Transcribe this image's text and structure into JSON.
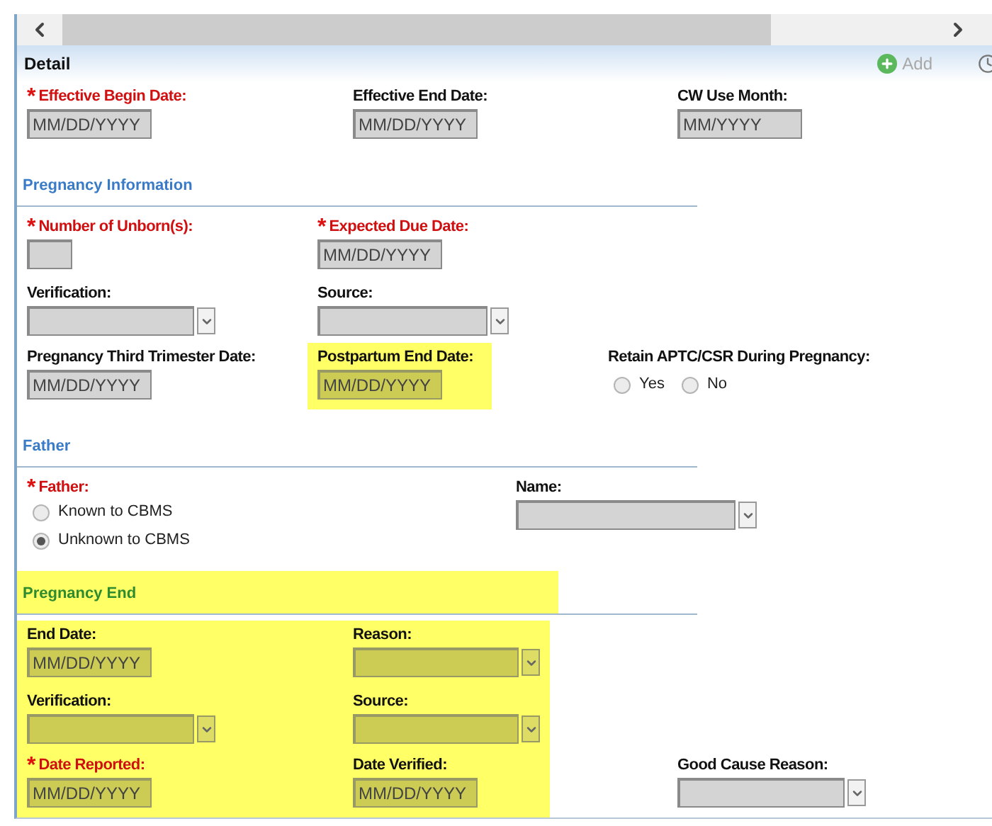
{
  "panel": {
    "title": "Detail",
    "add_button": {
      "label": "Add",
      "disabled": true
    }
  },
  "sections": [
    {
      "highlighted": false,
      "rows": [
        [
          {
            "kind": "date",
            "label": "Effective Begin Date:",
            "marker": "*",
            "placeholder": "MM/DD/YYYY",
            "highlighted": false
          },
          {
            "kind": "date",
            "label": "Effective End Date:",
            "placeholder": "MM/DD/YYYY",
            "highlighted": false
          },
          {
            "kind": "date",
            "label": "CW Use Month:",
            "placeholder": "MM/YYYY",
            "highlighted": false
          }
        ]
      ]
    },
    {
      "title": "Pregnancy Information",
      "highlighted": false,
      "rows": [
        [
          {
            "kind": "text",
            "label": "Number of Unborn(s):",
            "marker": "*",
            "highlighted": false
          },
          {
            "kind": "date",
            "label": "Expected Due Date:",
            "marker": "*",
            "placeholder": "MM/DD/YYYY",
            "highlighted": false
          }
        ],
        [
          {
            "kind": "select",
            "label": "Verification:",
            "highlighted": false
          },
          {
            "kind": "select",
            "label": "Source:",
            "highlighted": false
          }
        ],
        [
          {
            "kind": "date",
            "label": "Pregnancy Third Trimester Date:",
            "placeholder": "MM/DD/YYYY",
            "highlighted": false
          },
          {
            "kind": "date",
            "label": "Postpartum End Date:",
            "placeholder": "MM/DD/YYYY",
            "highlighted": true
          },
          {
            "kind": "radio-row",
            "label": "Retain APTC/CSR During Pregnancy:",
            "highlighted": false,
            "options": [
              {
                "label": "Yes",
                "selected": false
              },
              {
                "label": "No",
                "selected": false
              }
            ]
          }
        ]
      ]
    },
    {
      "title": "Father",
      "highlighted": false,
      "rows": [
        [
          {
            "kind": "radio-list",
            "label": "Father:",
            "marker": "*",
            "highlighted": false,
            "options": [
              {
                "label": "Known to CBMS",
                "selected": false
              },
              {
                "label": "Unknown to CBMS",
                "selected": true
              }
            ]
          },
          {
            "kind": "select",
            "label": "Name:",
            "highlighted": false
          }
        ]
      ]
    },
    {
      "title": "Pregnancy End",
      "highlighted": true,
      "rows": [
        [
          {
            "kind": "date",
            "label": "End Date:",
            "placeholder": "MM/DD/YYYY",
            "highlighted": true
          },
          {
            "kind": "select",
            "label": "Reason:",
            "highlighted": true
          }
        ],
        [
          {
            "kind": "select",
            "label": "Verification:",
            "highlighted": true
          },
          {
            "kind": "select",
            "label": "Source:",
            "highlighted": true
          }
        ],
        [
          {
            "kind": "date",
            "label": "Date Reported:",
            "marker": "*",
            "placeholder": "MM/DD/YYYY",
            "highlighted": true
          },
          {
            "kind": "date",
            "label": "Date Verified:",
            "placeholder": "MM/DD/YYYY",
            "highlighted": true
          },
          {
            "kind": "select",
            "label": "Good Cause Reason:",
            "highlighted": false
          }
        ]
      ]
    }
  ]
}
